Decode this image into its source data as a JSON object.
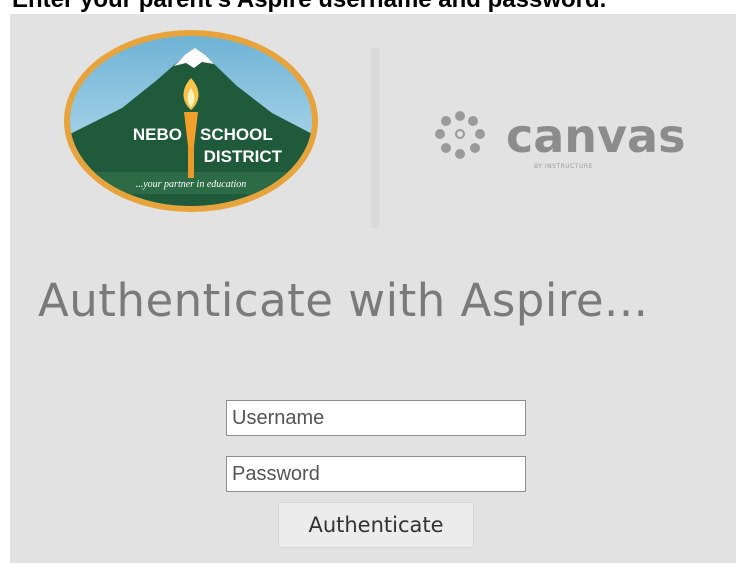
{
  "top_instruction": "Enter your parent's Aspire username and password.",
  "logos": {
    "nebo": {
      "line1_left": "NEBO",
      "line1_right": "SCHOOL",
      "line2": "DISTRICT",
      "tagline": "...your partner in education"
    },
    "canvas": {
      "wordmark": "canvas",
      "byline": "BY INSTRUCTURE"
    }
  },
  "heading": "Authenticate with Aspire...",
  "form": {
    "username_placeholder": "Username",
    "password_placeholder": "Password",
    "submit_label": "Authenticate"
  },
  "colors": {
    "panel_bg": "#e2e2e2",
    "nebo_green": "#1f5a3a",
    "nebo_gold": "#e8a43c",
    "heading_gray": "#7a7a7a",
    "canvas_gray": "#8c8c8c"
  }
}
